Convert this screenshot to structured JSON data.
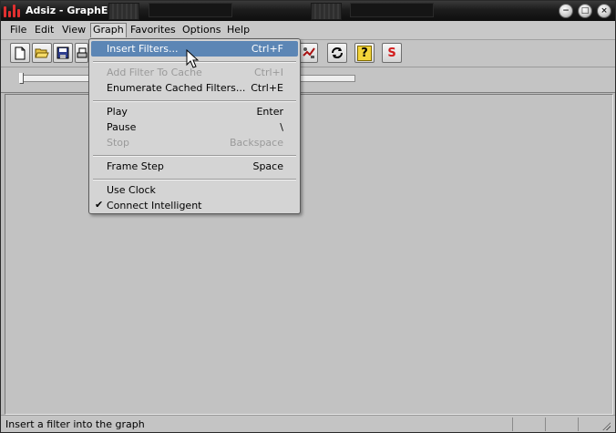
{
  "window": {
    "title": "Adsiz - GraphEdit"
  },
  "menubar": {
    "items": [
      {
        "label": "File"
      },
      {
        "label": "Edit"
      },
      {
        "label": "View"
      },
      {
        "label": "Graph"
      },
      {
        "label": "Favorites"
      },
      {
        "label": "Options"
      },
      {
        "label": "Help"
      }
    ],
    "active": "Graph"
  },
  "toolbar": {
    "buttons": [
      {
        "icon": "new-document-icon"
      },
      {
        "icon": "open-folder-icon"
      },
      {
        "icon": "save-disk-icon"
      },
      {
        "icon": "print-icon"
      },
      {
        "icon": "filter-graph-icon"
      },
      {
        "icon": "refresh-icon"
      },
      {
        "icon": "help-icon",
        "label": "?"
      },
      {
        "icon": "seek-icon",
        "label": "S"
      }
    ]
  },
  "slider": {
    "value": 0
  },
  "graph_menu": {
    "items": [
      {
        "label": "Insert Filters...",
        "accel": "Ctrl+F",
        "enabled": true,
        "highlighted": true,
        "checked": false
      },
      {
        "separator": true
      },
      {
        "label": "Add Filter To Cache",
        "accel": "Ctrl+I",
        "enabled": false,
        "highlighted": false,
        "checked": false
      },
      {
        "label": "Enumerate Cached Filters...",
        "accel": "Ctrl+E",
        "enabled": true,
        "highlighted": false,
        "checked": false
      },
      {
        "separator": true
      },
      {
        "label": "Play",
        "accel": "Enter",
        "enabled": true,
        "highlighted": false,
        "checked": false
      },
      {
        "label": "Pause",
        "accel": "\\",
        "enabled": true,
        "highlighted": false,
        "checked": false
      },
      {
        "label": "Stop",
        "accel": "Backspace",
        "enabled": false,
        "highlighted": false,
        "checked": false
      },
      {
        "separator": true
      },
      {
        "label": "Frame Step",
        "accel": "Space",
        "enabled": true,
        "highlighted": false,
        "checked": false
      },
      {
        "separator": true
      },
      {
        "label": "Use Clock",
        "accel": "",
        "enabled": true,
        "highlighted": false,
        "checked": false
      },
      {
        "label": "Connect Intelligent",
        "accel": "",
        "enabled": true,
        "highlighted": false,
        "checked": true
      }
    ]
  },
  "statusbar": {
    "text": "Insert a filter into the graph"
  },
  "colors": {
    "menu_highlight": "#5c86b5",
    "titlebar": "#111111",
    "canvas": "#c2c2c2"
  }
}
